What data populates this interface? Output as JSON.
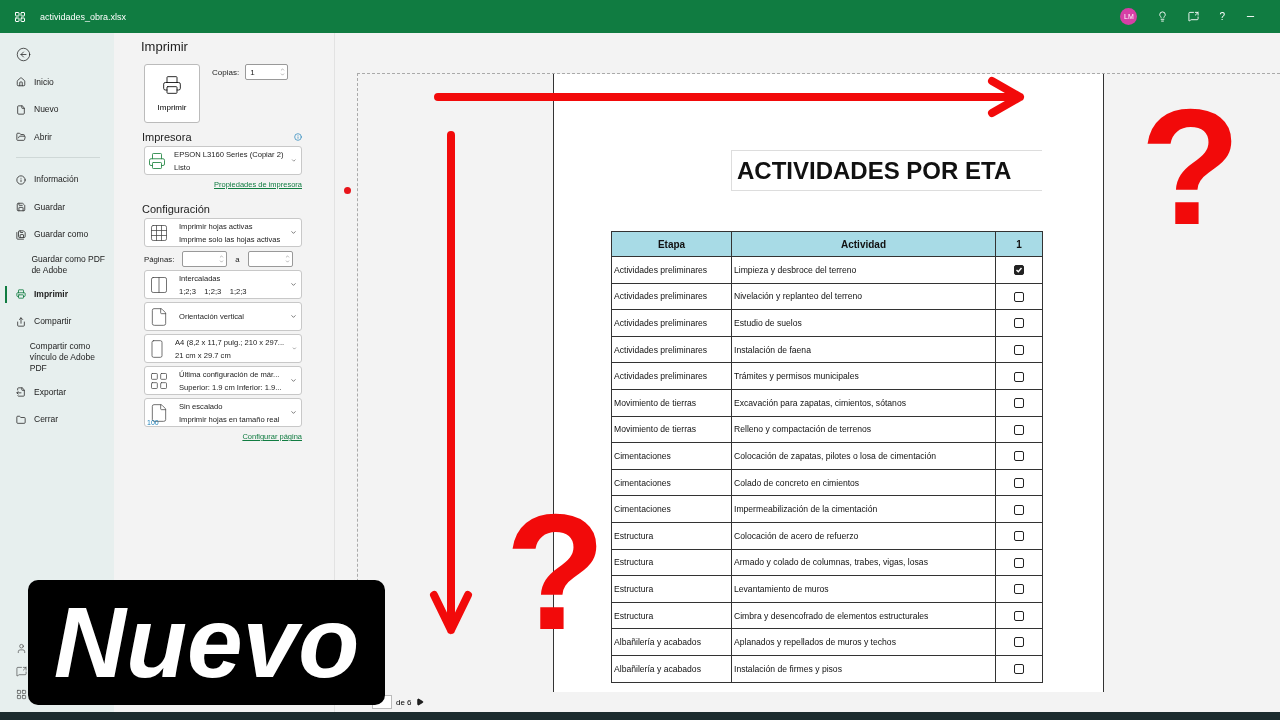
{
  "window": {
    "title": "actividades_obra.xlsx",
    "avatar": "LM",
    "help": "?"
  },
  "nav": {
    "groups": [
      [
        {
          "label": "Inicio",
          "selected": false
        },
        {
          "label": "Nuevo",
          "selected": false
        },
        {
          "label": "Abrir",
          "selected": false
        }
      ],
      [
        {
          "label": "Información",
          "selected": false
        },
        {
          "label": "Guardar",
          "selected": false
        },
        {
          "label": "Guardar como",
          "selected": false
        },
        {
          "label": "Guardar como PDF de Adobe",
          "selected": false
        },
        {
          "label": "Imprimir",
          "selected": true
        },
        {
          "label": "Compartir",
          "selected": false
        },
        {
          "label": "Compartir como vínculo de Adobe PDF",
          "selected": false
        },
        {
          "label": "Exportar",
          "selected": false
        },
        {
          "label": "Cerrar",
          "selected": false
        }
      ]
    ]
  },
  "print": {
    "heading": "Imprimir",
    "button": "Imprimir",
    "copies_label": "Copias:",
    "copies": "1",
    "printer_heading": "Impresora",
    "printer": {
      "name": "EPSON L3160 Series (Copiar 2)",
      "status": "Listo"
    },
    "printer_link": "Propiedades de impresora",
    "settings_heading": "Configuración",
    "pages_label": "Páginas:",
    "pages_to": "a",
    "settings": [
      {
        "title": "Imprimir hojas activas",
        "detail": "Imprime solo las hojas activas"
      },
      {
        "title": "Intercaladas",
        "detail": "1;2;3    1;2;3    1;2;3"
      },
      {
        "title": "Orientación vertical"
      },
      {
        "title": "A4 (8,2 x 11,7 pulg.; 210 x 297...",
        "detail": "21 cm x 29.7 cm"
      },
      {
        "title": "Última configuración de már...",
        "detail": "Superior: 1.9 cm Inferior: 1.9..."
      },
      {
        "title": "Sin escalado",
        "detail": "Imprimir hojas en tamaño real",
        "icon_text": "100"
      }
    ],
    "setup_link": "Configurar página"
  },
  "preview": {
    "title": "ACTIVIDADES POR ETA",
    "columns": [
      "Etapa",
      "Actividad",
      "1"
    ],
    "rows": [
      {
        "stage": "Actividades preliminares",
        "activity": "Limpieza y desbroce del terreno",
        "checked": true
      },
      {
        "stage": "Actividades preliminares",
        "activity": "Nivelación y replanteo del terreno",
        "checked": false
      },
      {
        "stage": "Actividades preliminares",
        "activity": "Estudio de suelos",
        "checked": false
      },
      {
        "stage": "Actividades preliminares",
        "activity": "Instalación de faena",
        "checked": false
      },
      {
        "stage": "Actividades preliminares",
        "activity": "Trámites y permisos municipales",
        "checked": false
      },
      {
        "stage": "Movimiento de tierras",
        "activity": "Excavación para zapatas, cimientos, sótanos",
        "checked": false
      },
      {
        "stage": "Movimiento de tierras",
        "activity": "Relleno y compactación de terrenos",
        "checked": false
      },
      {
        "stage": "Cimentaciones",
        "activity": "Colocación de zapatas, pilotes o losa de cimentación",
        "checked": false
      },
      {
        "stage": "Cimentaciones",
        "activity": "Colado de concreto en cimientos",
        "checked": false
      },
      {
        "stage": "Cimentaciones",
        "activity": "Impermeabilización de la cimentación",
        "checked": false
      },
      {
        "stage": "Estructura",
        "activity": "Colocación de acero de refuerzo",
        "checked": false
      },
      {
        "stage": "Estructura",
        "activity": "Armado y colado de columnas, trabes, vigas, losas",
        "checked": false
      },
      {
        "stage": "Estructura",
        "activity": "Levantamiento de muros",
        "checked": false
      },
      {
        "stage": "Estructura",
        "activity": "Cimbra y desencofrado de elementos estructurales",
        "checked": false
      },
      {
        "stage": "Albañilería y acabados",
        "activity": "Aplanados y repellados de muros y techos",
        "checked": false
      },
      {
        "stage": "Albañilería y acabados",
        "activity": "Instalación de firmes y pisos",
        "checked": false
      }
    ],
    "page_label": "de 6"
  },
  "overlay": {
    "badge": "Nuevo",
    "marks": [
      "?",
      "?"
    ]
  }
}
